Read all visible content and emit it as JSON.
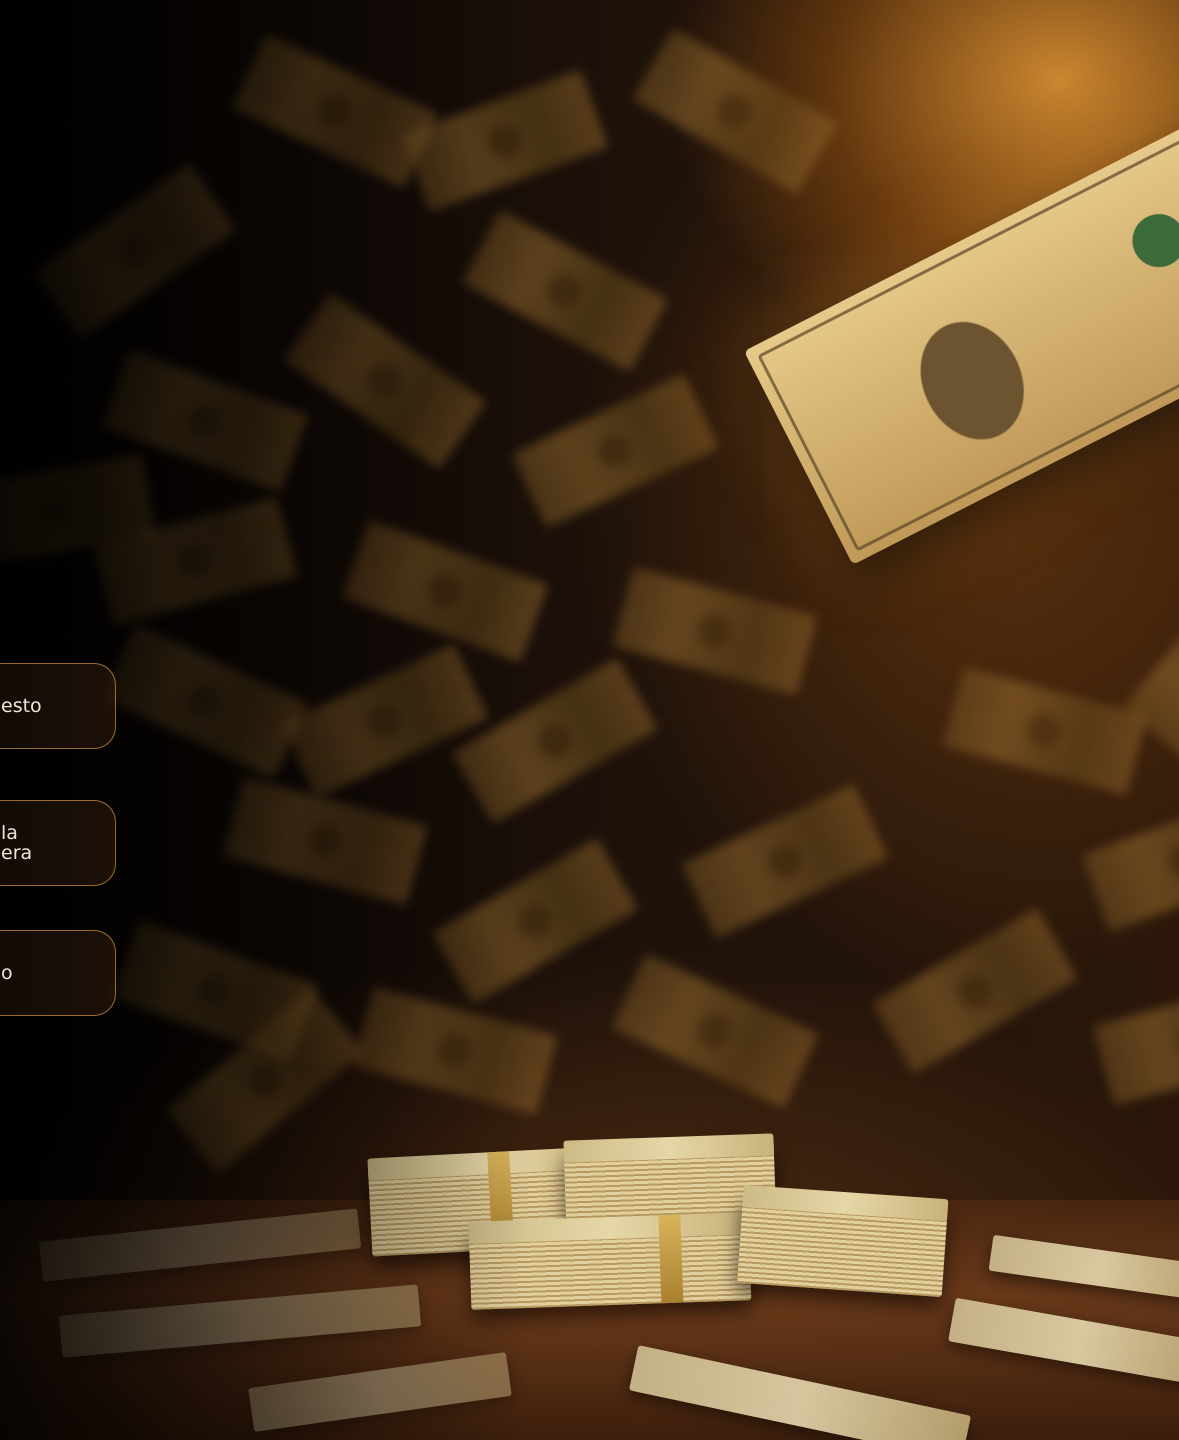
{
  "menu": {
    "item_1": {
      "line_1": "esto"
    },
    "item_2": {
      "line_1": "la",
      "line_2": "era"
    },
    "item_3": {
      "line_1": "o"
    }
  },
  "colors": {
    "accent": "#c88c3c",
    "text": "#f2e6d6",
    "background": "#0c0705"
  }
}
